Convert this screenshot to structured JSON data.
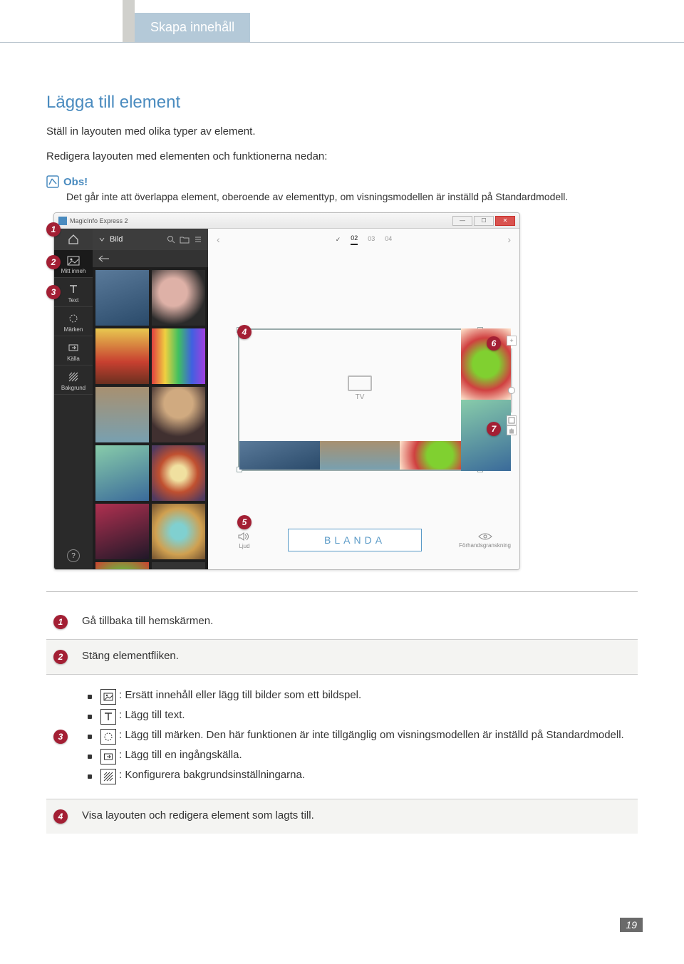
{
  "header": {
    "breadcrumb": "Skapa innehåll"
  },
  "section": {
    "title": "Lägga till element",
    "intro1": "Ställ in layouten med olika typer av element.",
    "intro2": "Redigera layouten med elementen och funktionerna nedan:",
    "note_label": "Obs!",
    "note_text": "Det går inte att överlappa element, oberoende av elementtyp, om visningsmodellen är inställd på Standardmodell."
  },
  "app": {
    "title": "MagicInfo Express 2",
    "panel_title": "Bild",
    "rail": {
      "content": "Mitt inneh",
      "text": "Text",
      "brands": "Märken",
      "source": "Källa",
      "background": "Bakgrund"
    },
    "pages": {
      "p2": "02",
      "p3": "03",
      "p4": "04"
    },
    "tv": "TV",
    "audio": "Ljud",
    "blend": "BLANDA",
    "preview": "Förhandsgranskning",
    "zoom_plus": "+",
    "help": "?"
  },
  "callouts": {
    "c1": "1",
    "c2": "2",
    "c3": "3",
    "c4": "4",
    "c5": "5",
    "c6": "6",
    "c7": "7"
  },
  "legend": {
    "r1": "Gå tillbaka till hemskärmen.",
    "r2": "Stäng elementfliken.",
    "r3_a": ": Ersätt innehåll eller lägg till bilder som ett bildspel.",
    "r3_b": ": Lägg till text.",
    "r3_c": ": Lägg till märken. Den här funktionen är inte tillgänglig om visningsmodellen är inställd på Standardmodell.",
    "r3_d": ": Lägg till en ingångskälla.",
    "r3_e": ": Konfigurera bakgrundsinställningarna.",
    "r4": "Visa layouten och redigera element som lagts till."
  },
  "page_number": "19"
}
